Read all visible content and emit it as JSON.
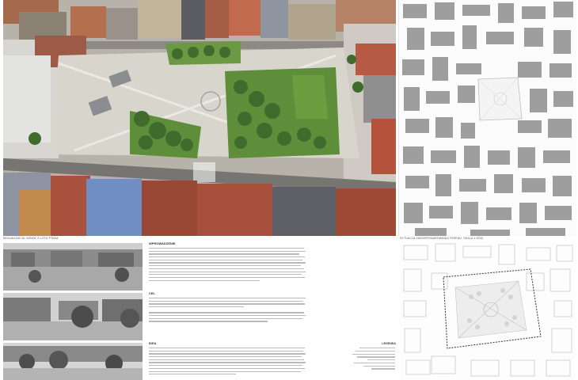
{
  "captions": {
    "aerial": "WIZUALIZACJA: WIDOK Z LOTU PTAKA",
    "plan_top": "SYTUACJA ZAGOSPODAROWANIA TERENU, SKALA 1:1000"
  },
  "sections": [
    {
      "title": "WPROWADZENIE",
      "lines": 12
    },
    {
      "title": "CEL",
      "lines": 8
    },
    {
      "title": "IDEA",
      "lines": 10
    }
  ],
  "legend": {
    "title": "LEGENDA",
    "items": 8
  },
  "colors": {
    "grass": "#5f8e3a",
    "tree": "#3f6b2c",
    "roof_red": "#9c4a34",
    "paving": "#d8d5cd",
    "building_plan": "#9e9e9e"
  }
}
